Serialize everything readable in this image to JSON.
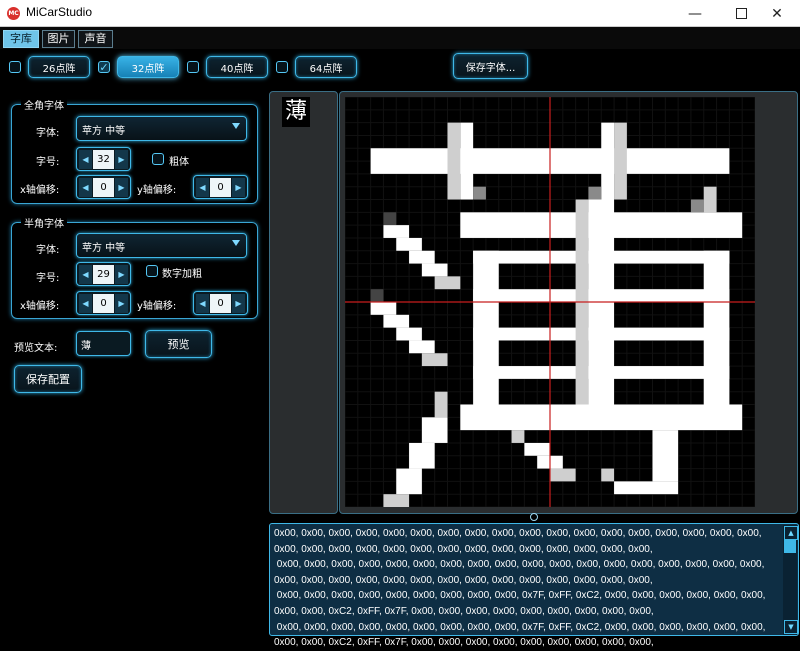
{
  "window": {
    "title": "MiCarStudio",
    "icon_text": "MC"
  },
  "tabs": [
    {
      "label": "字库",
      "active": true
    },
    {
      "label": "图片",
      "active": false
    },
    {
      "label": "声音",
      "active": false
    }
  ],
  "size_options": [
    {
      "label": "26点阵",
      "checked": false
    },
    {
      "label": "32点阵",
      "checked": true
    },
    {
      "label": "40点阵",
      "checked": false
    },
    {
      "label": "64点阵",
      "checked": false
    }
  ],
  "save_font_label": "保存字体...",
  "fullwidth": {
    "title": "全角字体",
    "font_label": "字体:",
    "font_value": "苹方 中等",
    "size_label": "字号:",
    "size_value": "32",
    "bold_label": "粗体",
    "x_offset_label": "x轴偏移:",
    "x_offset_value": "0",
    "y_offset_label": "y轴偏移:",
    "y_offset_value": "0"
  },
  "halfwidth": {
    "title": "半角字体",
    "font_label": "字体:",
    "font_value": "苹方 中等",
    "size_label": "字号:",
    "size_value": "29",
    "bold_label": "数字加粗",
    "x_offset_label": "x轴偏移:",
    "x_offset_value": "0",
    "y_offset_label": "y轴偏移:",
    "y_offset_value": "0"
  },
  "preview": {
    "label": "预览文本:",
    "value": "薄",
    "button": "预览"
  },
  "save_config_label": "保存配置",
  "glyph_char": "薄",
  "colors": {
    "accent": "#3fb8e8",
    "selected_tab": "#6fc4e9",
    "crosshair": "#c81e1e",
    "hex_bg": "#0e2e44"
  },
  "hex_output": "0x00, 0x00, 0x00, 0x00, 0x00, 0x00, 0x00, 0x00, 0x00, 0x00, 0x00, 0x00, 0x00, 0x00, 0x00, 0x00, 0x00, 0x00,\n0x00, 0x00, 0x00, 0x00, 0x00, 0x00, 0x00, 0x00, 0x00, 0x00, 0x00, 0x00, 0x00, 0x00,\n 0x00, 0x00, 0x00, 0x00, 0x00, 0x00, 0x00, 0x00, 0x00, 0x00, 0x00, 0x00, 0x00, 0x00, 0x00, 0x00, 0x00, 0x00,\n0x00, 0x00, 0x00, 0x00, 0x00, 0x00, 0x00, 0x00, 0x00, 0x00, 0x00, 0x00, 0x00, 0x00,\n 0x00, 0x00, 0x00, 0x00, 0x00, 0x00, 0x00, 0x00, 0x00, 0x7F, 0xFF, 0xC2, 0x00, 0x00, 0x00, 0x00, 0x00, 0x00,\n0x00, 0x00, 0xC2, 0xFF, 0x7F, 0x00, 0x00, 0x00, 0x00, 0x00, 0x00, 0x00, 0x00, 0x00,\n 0x00, 0x00, 0x00, 0x00, 0x00, 0x00, 0x00, 0x00, 0x00, 0x7F, 0xFF, 0xC2, 0x00, 0x00, 0x00, 0x00, 0x00, 0x00,\n0x00, 0x00, 0xC2, 0xFF, 0x7F, 0x00, 0x00, 0x00, 0x00, 0x00, 0x00, 0x00, 0x00, 0x00,"
}
